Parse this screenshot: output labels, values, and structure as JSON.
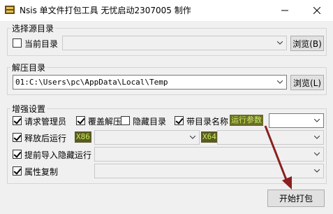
{
  "window": {
    "title": "Nsis 单文件打包工具 无忧启动2307005 制作"
  },
  "source_group": {
    "label": "选择源目录",
    "current_dir_label": "当前目录",
    "current_dir_checked": false,
    "path_value": "",
    "browse_label": "浏览(B)"
  },
  "extract_group": {
    "label": "解压目录",
    "path_value": "01:C:\\Users\\pc\\AppData\\Local\\Temp",
    "browse_label": "浏览(L)"
  },
  "enhance_group": {
    "label": "增强设置",
    "request_admin": {
      "label": "请求管理员",
      "checked": true
    },
    "overwrite_extract": {
      "label": "覆盖解压",
      "checked": true
    },
    "hide_dir": {
      "label": "隐藏目录",
      "checked": false
    },
    "with_dir_name": {
      "label": "带目录名称",
      "checked": true
    },
    "run_params_tag": "运行参数",
    "run_params_value": "",
    "run_after_release": {
      "label": "释放后运行",
      "checked": true
    },
    "x86_tag": "X86",
    "x86_value": "",
    "x64_tag": "X64",
    "x64_value": "",
    "pre_import_hidden_run": {
      "label": "提前导入隐藏运行",
      "checked": true
    },
    "pre_import_value": "",
    "copy_attributes": {
      "label": "属性复制",
      "checked": true
    },
    "copy_attributes_value": ""
  },
  "start_pack_label": "开始打包",
  "colors": {
    "annotation_arrow": "#8a2020",
    "tag_bg": "#6b6b2a",
    "tag_text": "#c8f05a"
  }
}
